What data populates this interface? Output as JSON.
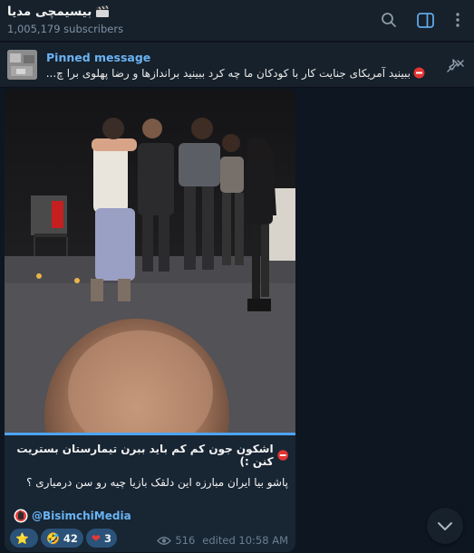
{
  "channel": {
    "title": "بیسیمچی مدیا",
    "subscribers": "1,005,179 subscribers"
  },
  "pinned": {
    "label": "Pinned message",
    "text": "ببینید آمریکای جنایت کار با کودکان ما چه کرد ببینید براندازها و رضا پهلوی برا چ..."
  },
  "message": {
    "line1": "اشکون جون کم کم باید ببرن تیمارستان بستریت کنن :)",
    "line2": "پاشو بیا ایران مبارزه این دلقک بازیا چیه رو سن درمیاری ؟",
    "signature": "@BisimchiMedia",
    "reactions": [
      {
        "emoji": "⭐",
        "count": ""
      },
      {
        "emoji": "🤣",
        "count": "42"
      },
      {
        "emoji": "❤",
        "count": "3"
      }
    ],
    "views": "516",
    "edited": "edited 10:58 AM",
    "video_progress": 1.0
  },
  "colors": {
    "accent": "#6ab3f3",
    "reaction_bg": "#2b5278",
    "bubble_bg": "#182533",
    "header_bg": "#17212b",
    "background": "#0e1621"
  },
  "icons": [
    "search-icon",
    "sidebar-toggle-icon",
    "more-vertical-icon",
    "unpin-icon",
    "eye-icon",
    "chevron-down-icon",
    "red-circle-badge-icon",
    "clapperboard-icon"
  ]
}
